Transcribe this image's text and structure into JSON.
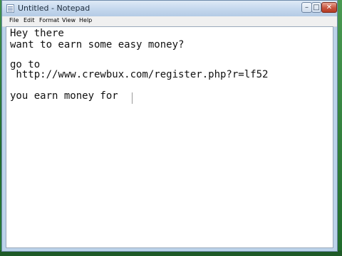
{
  "window": {
    "title": "Untitled - Notepad",
    "controls": {
      "minimize": "–",
      "maximize": "□",
      "close": "✕"
    }
  },
  "menu": {
    "items": [
      "File",
      "Edit",
      "Format",
      "View",
      "Help"
    ]
  },
  "editor": {
    "lines": [
      "Hey there",
      "want to earn some easy money?",
      "",
      "go to",
      " http://www.crewbux.com/register.php?r=lf52",
      "",
      "you earn money for "
    ]
  }
}
